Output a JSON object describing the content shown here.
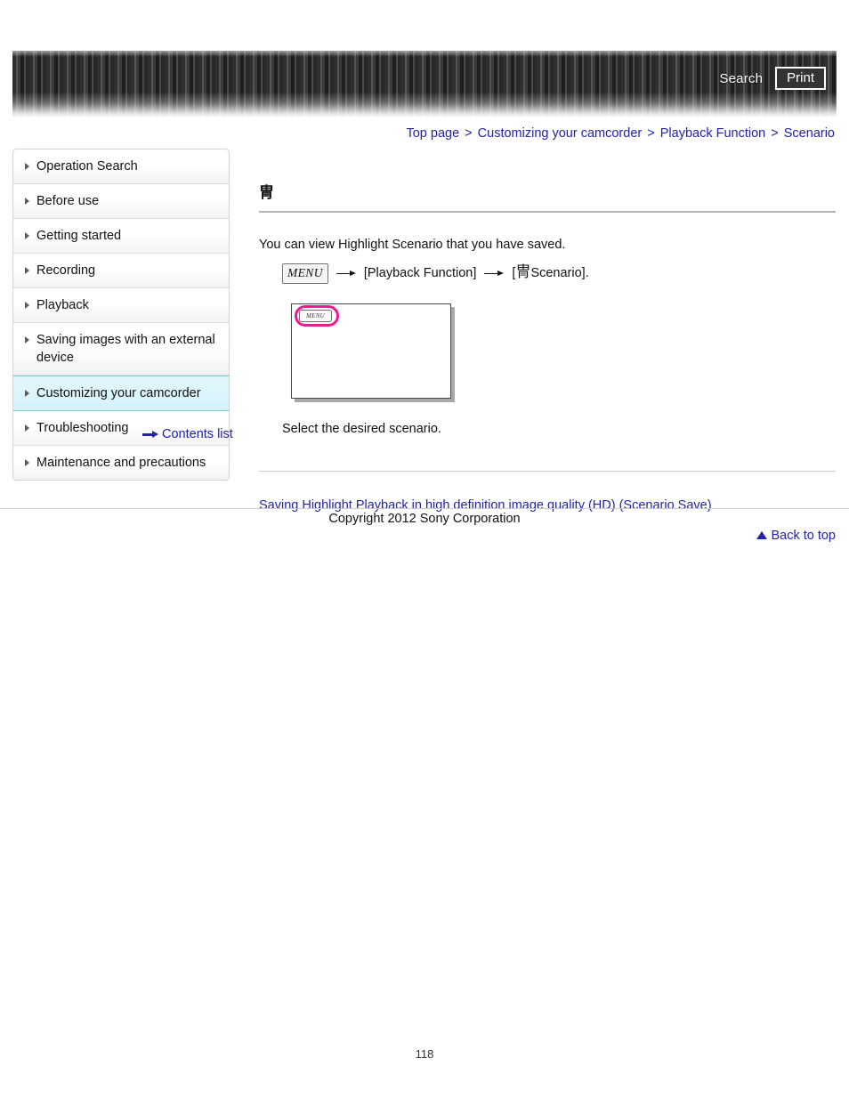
{
  "header": {
    "search_label": "Search",
    "print_label": "Print"
  },
  "breadcrumb": {
    "separator": ">",
    "items": [
      {
        "label": "Top page"
      },
      {
        "label": "Customizing your camcorder"
      },
      {
        "label": "Playback Function"
      },
      {
        "label": "Scenario"
      }
    ]
  },
  "sidebar": {
    "items": [
      {
        "label": "Operation Search",
        "selected": false
      },
      {
        "label": "Before use",
        "selected": false
      },
      {
        "label": "Getting started",
        "selected": false
      },
      {
        "label": "Recording",
        "selected": false
      },
      {
        "label": "Playback",
        "selected": false
      },
      {
        "label": "Saving images with an external device",
        "selected": false
      },
      {
        "label": "Customizing your camcorder",
        "selected": true
      },
      {
        "label": "Troubleshooting",
        "selected": false
      },
      {
        "label": "Maintenance and precautions",
        "selected": false
      }
    ],
    "contents_list_label": "Contents list",
    "contents_list_icon": "arrow-right-icon"
  },
  "main": {
    "title_glyph": "冑",
    "intro": "You can view Highlight Scenario that you have saved.",
    "menu_path": {
      "menu_chip_label": "MENU",
      "step_1": "[Playback Function]",
      "step_2_prefix": "[",
      "step_2_glyph": "冑",
      "step_2_label": "Scenario",
      "step_2_suffix": "].",
      "arrow_icon": "arrow-right-icon"
    },
    "illustration": {
      "menu_chip_label": "MENU",
      "highlight_color": "#ec1c8e"
    },
    "caption": "Select the desired scenario.",
    "related_link": "Saving Highlight Playback in high definition image quality (HD) (Scenario Save)",
    "back_to_top_label": "Back to top",
    "back_to_top_icon": "triangle-up-icon"
  },
  "footer": {
    "copyright": "Copyright 2012 Sony Corporation",
    "page_number": "118"
  },
  "colors": {
    "link": "#2222aa",
    "selected_nav_bg": "#d7f2fa",
    "selected_nav_border": "#6fd0e4",
    "highlight_pink": "#ec1c8e"
  }
}
